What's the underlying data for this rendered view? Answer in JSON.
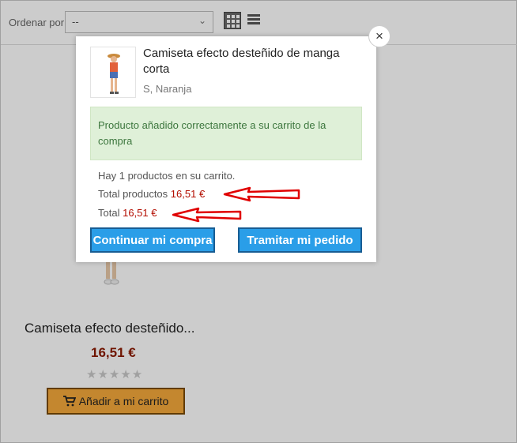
{
  "toolbar": {
    "sort_label": "Ordenar por",
    "sort_value": "--"
  },
  "product": {
    "name": "Camiseta efecto desteñido...",
    "price": "16,51 €",
    "rating_stars": "★★★★★",
    "add_to_cart_label": "Añadir a mi carrito"
  },
  "modal": {
    "title": "Camiseta efecto desteñido de manga corta",
    "variant": "S, Naranja",
    "success_message": "Producto añadido correctamente a su carrito de la compra",
    "cart_count_text": "Hay 1 productos en su carrito.",
    "total_products_label": "Total productos",
    "total_products_value": "16,51 €",
    "total_label": "Total",
    "total_value": "16,51 €",
    "continue_label": "Continuar mi compra",
    "checkout_label": "Tramitar mi pedido",
    "close_glyph": "×"
  },
  "colors": {
    "accent_button": "#2a9ee8",
    "success_bg": "#dff0d8",
    "price_red": "#b30d00",
    "cart_button": "#f5a93b",
    "annotation_arrow": "#e00000"
  }
}
